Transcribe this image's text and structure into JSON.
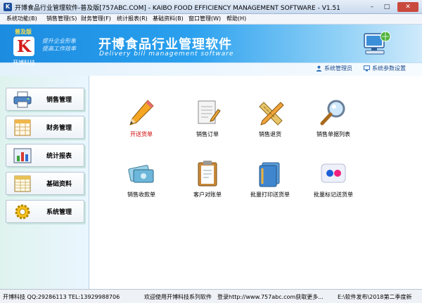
{
  "window": {
    "title": "开博食品行业管理软件-普及版[757ABC.COM] - KAIBO FOOD EFFICIENCY MANAGEMENT SOFTWARE - V1.51",
    "min": "–",
    "max": "□",
    "close": "✕"
  },
  "menu": [
    "系统功能(B)",
    "销售管理(S)",
    "财务管理(F)",
    "统计报表(R)",
    "基础资料(B)",
    "窗口管理(W)",
    "帮助(H)"
  ],
  "banner": {
    "edition": "普及版",
    "logo_letter": "K",
    "company": "开博科技",
    "slogan_1": "提升企业形象",
    "slogan_2": "提高工作效率",
    "product_name": "开博食品行业管理软件",
    "product_en": "Delivery bill management software",
    "admin": "系统管理员",
    "settings": "系统参数设置"
  },
  "sidebar": [
    {
      "label": "销售管理",
      "icon": "printer-icon"
    },
    {
      "label": "财务管理",
      "icon": "spreadsheet-icon"
    },
    {
      "label": "统计报表",
      "icon": "bar-chart-icon"
    },
    {
      "label": "基础资料",
      "icon": "data-grid-icon"
    },
    {
      "label": "系统管理",
      "icon": "gear-icon"
    }
  ],
  "tiles": [
    {
      "label": "开送货单",
      "icon": "pencil-icon",
      "active": true
    },
    {
      "label": "销售订单",
      "icon": "notepad-icon"
    },
    {
      "label": "销售退货",
      "icon": "ruler-pencil-icon"
    },
    {
      "label": "销售单据列表",
      "icon": "magnifier-icon"
    },
    {
      "label": "销售收款单",
      "icon": "money-card-icon"
    },
    {
      "label": "客户对账单",
      "icon": "clipboard-icon"
    },
    {
      "label": "批量打印送货单",
      "icon": "folders-icon"
    },
    {
      "label": "批量标记送货单",
      "icon": "flickr-icon"
    }
  ],
  "status": {
    "contact": "开博科技 QQ:29286113 TEL:13929988706",
    "welcome": "欢迎使用开博科技系列软件",
    "visit": "登录http://www.757abc.com获取更多...",
    "path": "E:\\软件发布\\2018第二季度新"
  },
  "colors": {
    "banner": "#1c8ce0",
    "active_label": "#d10000",
    "sidebar_bg": "#dff3ee"
  }
}
